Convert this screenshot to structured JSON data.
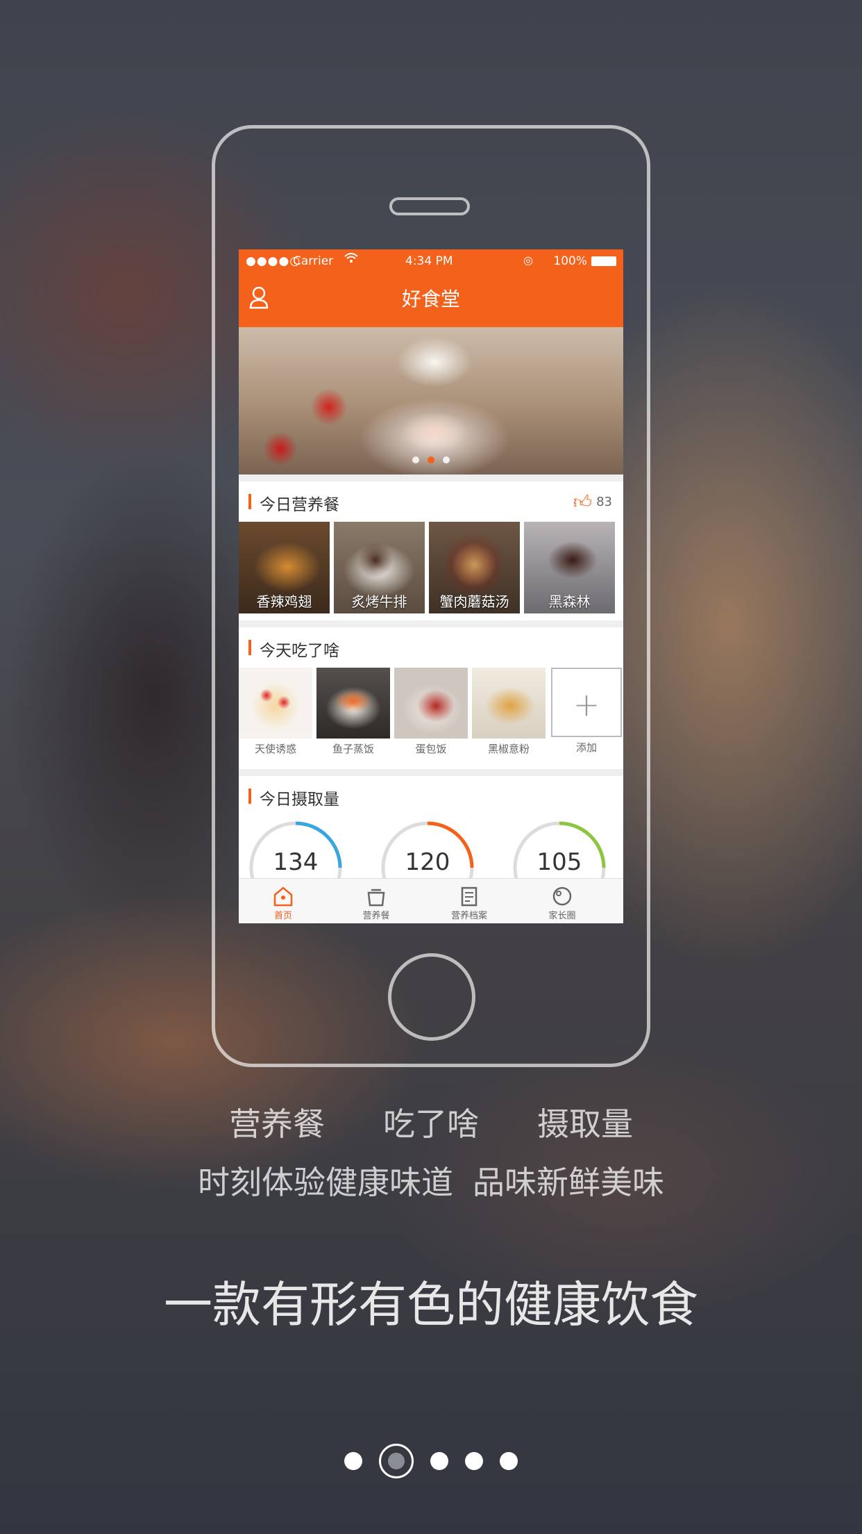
{
  "status_bar": {
    "signal": "●●●●○",
    "carrier": "Carrier",
    "time": "4:34 PM",
    "battery": "100%"
  },
  "app": {
    "title": "好食堂",
    "accent_color": "#f4611a"
  },
  "banner": {
    "dots_total": 3,
    "dots_active": 1
  },
  "nutrition_section": {
    "title": "今日营养餐",
    "like_count": "83",
    "items": [
      {
        "label": "香辣鸡翅"
      },
      {
        "label": "炙烤牛排"
      },
      {
        "label": "蟹肉蘑菇汤"
      },
      {
        "label": "黑森林"
      }
    ]
  },
  "eaten_section": {
    "title": "今天吃了啥",
    "items": [
      {
        "label": "天使诱惑"
      },
      {
        "label": "鱼子蒸饭"
      },
      {
        "label": "蛋包饭"
      },
      {
        "label": "黑椒意粉"
      }
    ],
    "add_label": "添加",
    "add_icon": "+"
  },
  "intake_section": {
    "title": "今日摄取量",
    "gauges": [
      {
        "value": "134",
        "color": "#3aa6e0"
      },
      {
        "value": "120",
        "color": "#f4611a"
      },
      {
        "value": "105",
        "color": "#8cc63f"
      }
    ]
  },
  "tabs": [
    {
      "label": "首页",
      "icon": "home-icon",
      "active": true
    },
    {
      "label": "营养餐",
      "icon": "pot-icon",
      "active": false
    },
    {
      "label": "营养档案",
      "icon": "document-icon",
      "active": false
    },
    {
      "label": "家长圈",
      "icon": "circle-icon",
      "active": false
    }
  ],
  "intro": {
    "features": [
      "营养餐",
      "吃了啥",
      "摄取量"
    ],
    "subtitle_a": "时刻体验健康味道",
    "subtitle_b": "品味新鲜美味",
    "slogan": "一款有形有色的健康饮食"
  },
  "pager": {
    "total": 5,
    "current": 2
  }
}
